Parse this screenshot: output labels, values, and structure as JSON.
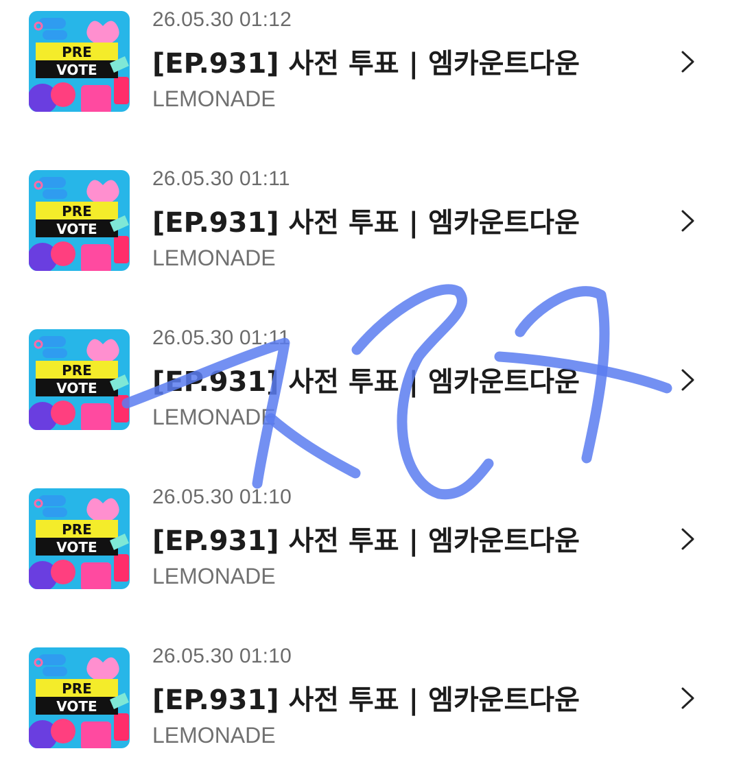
{
  "items": [
    {
      "timestamp": "26.05.30 01:12",
      "title": "[EP.931] 사전 투표 | 엠카운트다운",
      "artist": "LEMONADE",
      "thumb_text_1": "PRE",
      "thumb_text_2": "VOTE"
    },
    {
      "timestamp": "26.05.30 01:11",
      "title": "[EP.931] 사전 투표 | 엠카운트다운",
      "artist": "LEMONADE",
      "thumb_text_1": "PRE",
      "thumb_text_2": "VOTE"
    },
    {
      "timestamp": "26.05.30 01:11",
      "title": "[EP.931] 사전 투표 | 엠카운트다운",
      "artist": "LEMONADE",
      "thumb_text_1": "PRE",
      "thumb_text_2": "VOTE"
    },
    {
      "timestamp": "26.05.30 01:10",
      "title": "[EP.931] 사전 투표 | 엠카운트다운",
      "artist": "LEMONADE",
      "thumb_text_1": "PRE",
      "thumb_text_2": "VOTE"
    },
    {
      "timestamp": "26.05.30 01:10",
      "title": "[EP.931] 사전 투표 | 엠카운트다운",
      "artist": "LEMONADE",
      "thumb_text_1": "PRE",
      "thumb_text_2": "VOTE"
    }
  ],
  "icons": {
    "row_arrow": "chevron-right-icon"
  },
  "colors": {
    "annotation_stroke": "#5b7cf0",
    "thumb_bg": "#27b6e8",
    "thumb_banner": "#f4ec2a"
  }
}
